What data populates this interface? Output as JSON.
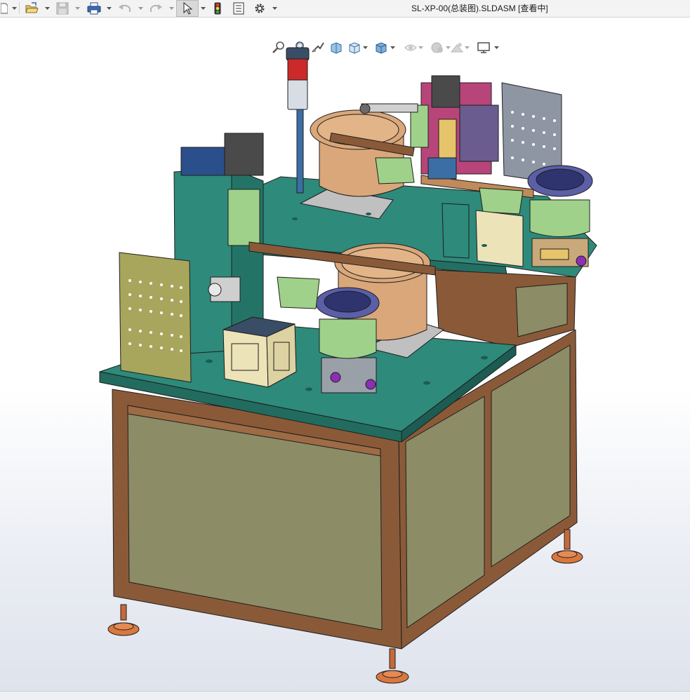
{
  "window": {
    "title": "SL-XP-00(总装图).SLDASM [查看中]"
  },
  "toolbar": {
    "buttons": [
      {
        "name": "new-document",
        "icon": "new-document-icon",
        "has_dropdown": true
      },
      {
        "name": "open",
        "icon": "open-folder-icon",
        "has_dropdown": true
      },
      {
        "name": "save",
        "icon": "save-icon",
        "has_dropdown": true,
        "disabled": true
      },
      {
        "name": "print",
        "icon": "printer-icon",
        "has_dropdown": true
      },
      {
        "name": "undo",
        "icon": "undo-icon",
        "has_dropdown": true,
        "disabled": true
      },
      {
        "name": "redo",
        "icon": "redo-icon",
        "has_dropdown": true,
        "disabled": true
      },
      {
        "name": "select",
        "icon": "select-arrow-icon",
        "has_dropdown": true,
        "active": true
      },
      {
        "name": "rebuild",
        "icon": "traffic-light-icon",
        "has_dropdown": false
      },
      {
        "name": "file-properties",
        "icon": "properties-icon",
        "has_dropdown": false
      },
      {
        "name": "options",
        "icon": "gear-icon",
        "has_dropdown": true
      }
    ]
  },
  "heads_up_toolbar": {
    "buttons": [
      {
        "name": "zoom-to-fit",
        "icon": "zoom-to-fit-icon"
      },
      {
        "name": "zoom-to-area",
        "icon": "zoom-area-icon"
      },
      {
        "name": "previous-view",
        "icon": "previous-view-icon"
      },
      {
        "name": "section-view",
        "icon": "section-view-icon"
      },
      {
        "name": "view-orientation",
        "icon": "view-orientation-icon",
        "has_dropdown": true
      },
      {
        "name": "display-style",
        "icon": "display-style-icon",
        "has_dropdown": true
      },
      {
        "name": "hide-show-items",
        "icon": "hide-show-icon",
        "has_dropdown": true,
        "disabled": true
      },
      {
        "name": "edit-appearance",
        "icon": "appearance-icon",
        "has_dropdown": true,
        "disabled": true
      },
      {
        "name": "apply-scene",
        "icon": "scene-icon",
        "has_dropdown": true,
        "disabled": true
      },
      {
        "name": "view-settings",
        "icon": "monitor-icon",
        "has_dropdown": true
      }
    ]
  },
  "colors": {
    "table_top": "#2e8a7a",
    "frame": "#8a5a38",
    "panel": "#8c8c66",
    "feeder_bowl": "#d9a77a",
    "base_plate": "#c0c0c0",
    "accent_pink": "#b8457a",
    "accent_green": "#9fd18a",
    "tower_red": "#cc2a2a",
    "tower_blue": "#3a6ea5"
  }
}
